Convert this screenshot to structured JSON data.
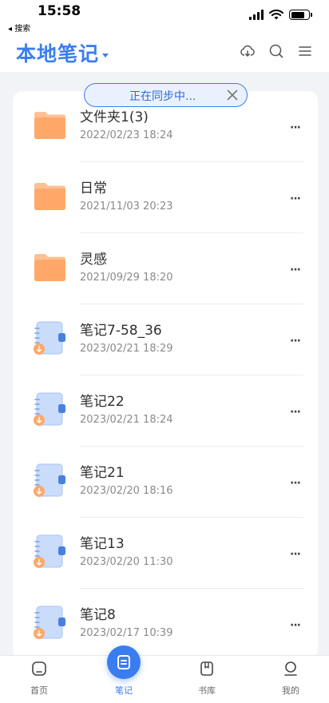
{
  "status_bar": {
    "time": "15:58",
    "back_app": "◂ 搜索"
  },
  "header": {
    "title": "本地笔记"
  },
  "sync_banner": {
    "text": "正在同步中..."
  },
  "items": [
    {
      "type": "folder",
      "name": "文件夹1(3)",
      "date": "2022/02/23 18:24"
    },
    {
      "type": "folder",
      "name": "日常",
      "date": "2021/11/03 20:23"
    },
    {
      "type": "folder",
      "name": "灵感",
      "date": "2021/09/29 18:20"
    },
    {
      "type": "notebook",
      "name": "笔记7-58_36",
      "date": "2023/02/21 18:29"
    },
    {
      "type": "notebook",
      "name": "笔记22",
      "date": "2023/02/21 18:24"
    },
    {
      "type": "notebook",
      "name": "笔记21",
      "date": "2023/02/20 18:16"
    },
    {
      "type": "notebook",
      "name": "笔记13",
      "date": "2023/02/20 11:30"
    },
    {
      "type": "notebook",
      "name": "笔记8",
      "date": "2023/02/17 10:39"
    }
  ],
  "more_label": "···",
  "tabs": [
    {
      "label": "首页",
      "icon": "home-icon"
    },
    {
      "label": "笔记",
      "icon": "note-icon",
      "active": true
    },
    {
      "label": "书库",
      "icon": "bookshelf-icon"
    },
    {
      "label": "我的",
      "icon": "profile-icon"
    }
  ],
  "colors": {
    "accent": "#3b7cf0",
    "folder": "#ffa86a",
    "notebook": "#c9dcfa"
  }
}
